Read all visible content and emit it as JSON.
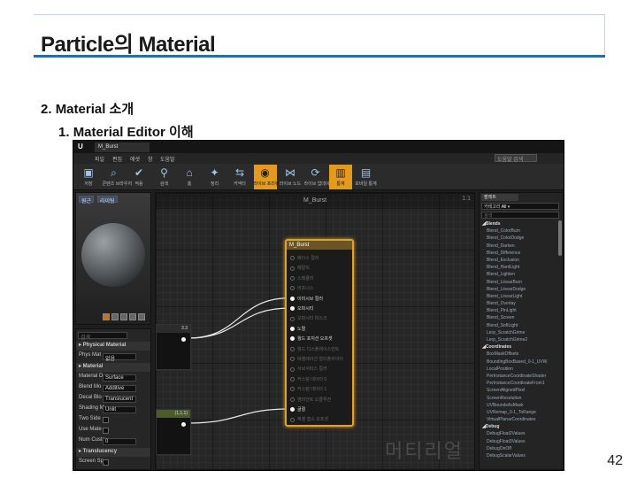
{
  "slide": {
    "title": "Particle의 Material",
    "bullets": [
      {
        "num": "2.",
        "text": "Material 소개"
      },
      {
        "num": "1.",
        "text": "Material Editor 이해"
      }
    ],
    "page_number": "42"
  },
  "editor": {
    "tab_title": "M_Burst",
    "menu": [
      "파일",
      "편집",
      "애셋",
      "창",
      "도움말"
    ],
    "search_help": "도움말 검색",
    "toolbar": [
      {
        "icon": "save-icon",
        "glyph": "▣",
        "label": "저장"
      },
      {
        "icon": "browse-icon",
        "glyph": "⌕",
        "label": "콘텐츠 브라우저"
      },
      {
        "icon": "apply-icon",
        "glyph": "✔",
        "label": "적용"
      },
      {
        "icon": "search-icon",
        "glyph": "⚲",
        "label": "검색"
      },
      {
        "icon": "home-icon",
        "glyph": "⌂",
        "label": "홈"
      },
      {
        "icon": "clean-icon",
        "glyph": "✦",
        "label": "정리"
      },
      {
        "icon": "connectors-icon",
        "glyph": "⇆",
        "label": "커넥터"
      },
      {
        "icon": "live-preview-icon",
        "glyph": "◉",
        "label": "라이브 프리뷰"
      },
      {
        "icon": "live-nodes-icon",
        "glyph": "⋈",
        "label": "라이브 노드"
      },
      {
        "icon": "live-update-icon",
        "glyph": "⟳",
        "label": "라이브 업데이트"
      },
      {
        "icon": "stats-icon",
        "glyph": "▥",
        "label": "통계"
      },
      {
        "icon": "mobile-stats-icon",
        "glyph": "▤",
        "label": "모바일 통계"
      }
    ],
    "active_tools": [
      7,
      10
    ],
    "viewport": {
      "buttons": [
        "원근",
        "라이팅"
      ]
    },
    "details": {
      "search_placeholder": "검색",
      "rows": [
        {
          "type": "head",
          "label": "▸ Physical Material"
        },
        {
          "type": "val",
          "label": "Phys Mat",
          "value": "없음"
        },
        {
          "type": "head",
          "label": "▸ Material"
        },
        {
          "type": "val",
          "label": "Material D",
          "value": "Surface"
        },
        {
          "type": "val",
          "label": "Blend Mo",
          "value": "Additive"
        },
        {
          "type": "val",
          "label": "Decal Blo",
          "value": "Translucent"
        },
        {
          "type": "val",
          "label": "Shading M",
          "value": "Unlit"
        },
        {
          "type": "check",
          "label": "Two Side"
        },
        {
          "type": "check",
          "label": "Use Mate"
        },
        {
          "type": "val",
          "label": "Num Custo",
          "value": "0"
        },
        {
          "type": "head",
          "label": "▸ Translucency"
        },
        {
          "type": "check",
          "label": "Screen Sp"
        }
      ]
    },
    "graph": {
      "title": "M_Burst",
      "zoom": "1:1",
      "watermark": "머티리얼",
      "material_node": {
        "title": "M_Burst",
        "pins": [
          {
            "label": "베이스 컬러",
            "active": false
          },
          {
            "label": "메탈릭",
            "active": false
          },
          {
            "label": "스페큘러",
            "active": false
          },
          {
            "label": "러프니스",
            "active": false
          },
          {
            "label": "이미시브 컬러",
            "active": true
          },
          {
            "label": "오파시티",
            "active": true
          },
          {
            "label": "오파시티 마스크",
            "active": false
          },
          {
            "label": "노멀",
            "active": true
          },
          {
            "label": "월드 포지션 오프셋",
            "active": true
          },
          {
            "label": "월드 디스플레이스먼트",
            "active": false
          },
          {
            "label": "테셀레이션 멀티플라이어",
            "active": false
          },
          {
            "label": "서브서피스 컬러",
            "active": false
          },
          {
            "label": "커스텀 데이터 0",
            "active": false
          },
          {
            "label": "커스텀 데이터 1",
            "active": false
          },
          {
            "label": "앰비언트 오클루전",
            "active": false
          },
          {
            "label": "굴절",
            "active": true
          },
          {
            "label": "픽셀 뎁스 오프셋",
            "active": false
          }
        ]
      },
      "side_nodes": [
        {
          "title": "3.3"
        },
        {
          "title": "(1,1,1)"
        }
      ]
    },
    "palette": {
      "tab": "팔레트",
      "category_label": "카테고리",
      "category_value": "All",
      "search_placeholder": "검색",
      "items": [
        {
          "cat": true,
          "label": "◢Blends"
        },
        {
          "label": "Blend_ColorBurn"
        },
        {
          "label": "Blend_ColorDodge"
        },
        {
          "label": "Blend_Darken"
        },
        {
          "label": "Blend_Difference"
        },
        {
          "label": "Blend_Exclusion"
        },
        {
          "label": "Blend_HardLight"
        },
        {
          "label": "Blend_Lighten"
        },
        {
          "label": "Blend_LinearBurn"
        },
        {
          "label": "Blend_LinearDodge"
        },
        {
          "label": "Blend_LinearLight"
        },
        {
          "label": "Blend_Overlay"
        },
        {
          "label": "Blend_PinLight"
        },
        {
          "label": "Blend_Screen"
        },
        {
          "label": "Blend_SoftLight"
        },
        {
          "label": "Lerp_ScratchGrime"
        },
        {
          "label": "Lerp_ScratchGrime2"
        },
        {
          "cat": true,
          "label": "◢Coordinates"
        },
        {
          "label": "BoxMaskOffsets"
        },
        {
          "label": "BoundingBoxBased_0-1_UVW"
        },
        {
          "label": "LocalPosition"
        },
        {
          "label": "PerInstanceCoordinateShader"
        },
        {
          "label": "PerInstanceCoordinateFrom1"
        },
        {
          "label": "ScreenAlignedPixel"
        },
        {
          "label": "ScreenResolution"
        },
        {
          "label": "UVBoundsAsMask"
        },
        {
          "label": "UVRemap_0-1_ToRange"
        },
        {
          "label": "VirtualPlanarCoordinates"
        },
        {
          "cat": true,
          "label": "◢Debug"
        },
        {
          "label": "DebugFloat2Values"
        },
        {
          "label": "DebugFloat3Values"
        },
        {
          "label": "DebugOnOff"
        },
        {
          "label": "DebugScalarValues"
        }
      ]
    }
  }
}
